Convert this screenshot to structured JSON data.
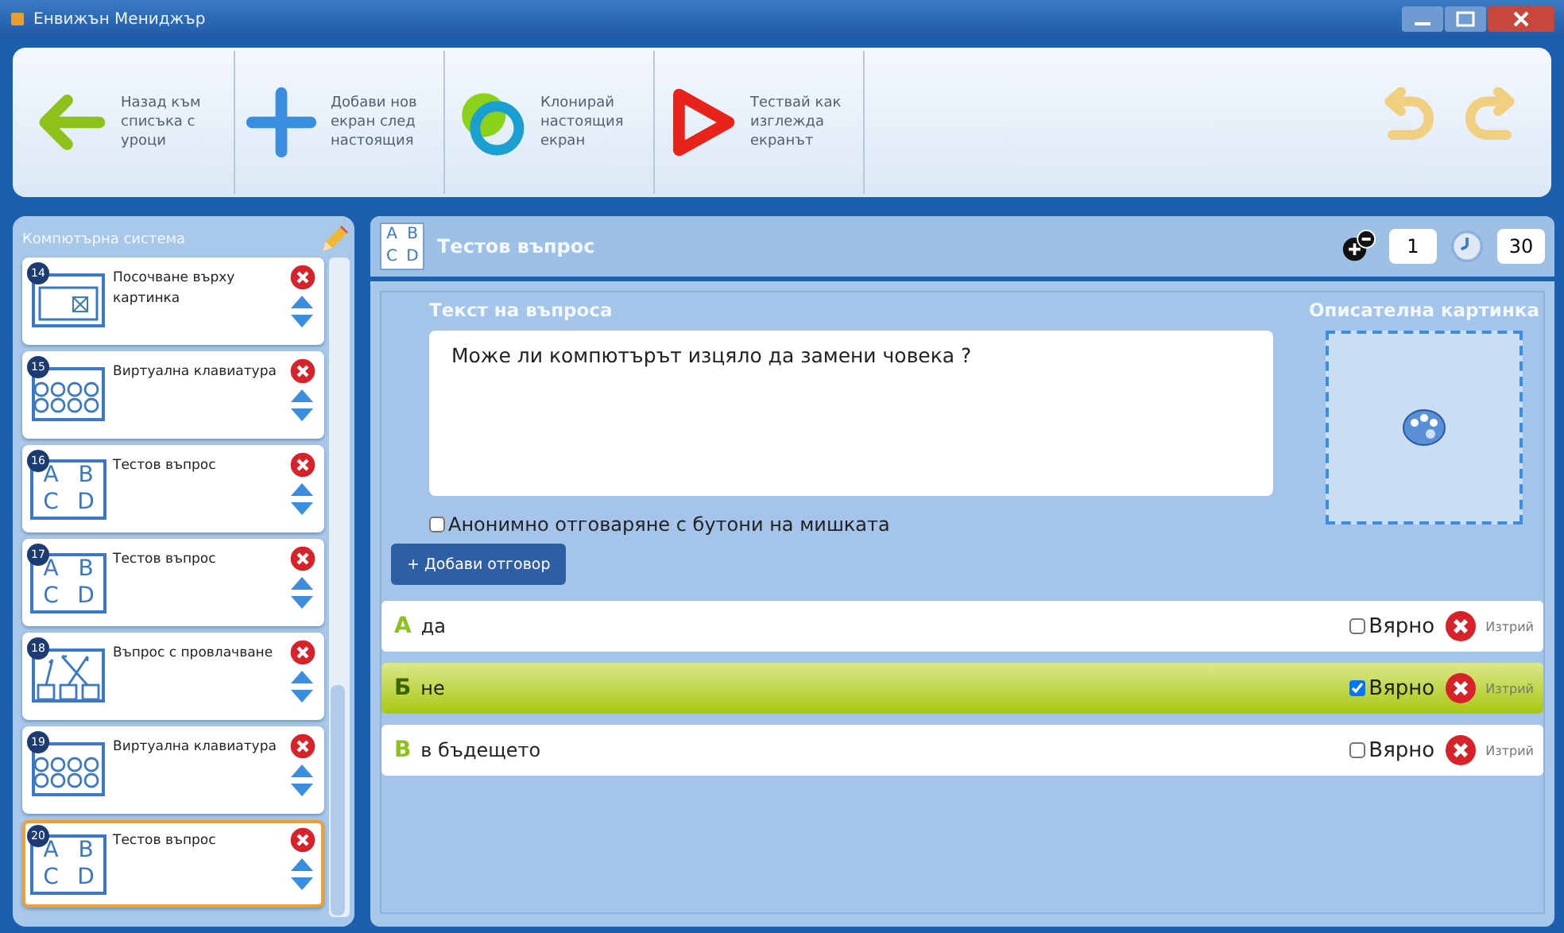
{
  "window": {
    "title": "Енвижън Мениджър"
  },
  "toolbar": [
    {
      "kind": "back",
      "label": "Назад към списъка с уроци"
    },
    {
      "kind": "add",
      "label": "Добави нов екран след настоящия"
    },
    {
      "kind": "clone",
      "label": "Клонирай настоящия екран"
    },
    {
      "kind": "test",
      "label": "Тествай как изглежда екранът"
    }
  ],
  "sidebar": {
    "title": "Компютърна система",
    "items": [
      {
        "number": "14",
        "kind": "pointing",
        "label": "Посочване върху картинка",
        "selected": false
      },
      {
        "number": "15",
        "kind": "keyboard",
        "label": "Виртуална клавиатура",
        "selected": false
      },
      {
        "number": "16",
        "kind": "abcd",
        "letters": [
          "A",
          "B",
          "C",
          "D"
        ],
        "label": "Тестов въпрос",
        "selected": false
      },
      {
        "number": "17",
        "kind": "abcd",
        "letters": [
          "A",
          "B",
          "C",
          "D"
        ],
        "label": "Тестов въпрос",
        "selected": false
      },
      {
        "number": "18",
        "kind": "drag",
        "label": "Въпрос с провлачване",
        "selected": false
      },
      {
        "number": "19",
        "kind": "keyboard",
        "label": "Виртуална клавиатура",
        "selected": false
      },
      {
        "number": "20",
        "kind": "abcd",
        "letters": [
          "A",
          "B",
          "C",
          "D"
        ],
        "label": "Тестов въпрос",
        "selected": true
      }
    ]
  },
  "header": {
    "letters": [
      "A",
      "B",
      "C",
      "D"
    ],
    "title": "Тестов въпрос",
    "points": "1",
    "seconds": "30"
  },
  "question": {
    "label": "Текст на въпроса",
    "value": "Може ли компютърът изцяло да замени човека ?",
    "picture_label": "Описателна картинка",
    "anonymous": {
      "label": "Анонимно отговаряне с бутони на мишката",
      "checked": false
    },
    "add_button": "+ Добави отговор"
  },
  "answers": [
    {
      "letter": "А",
      "text": "да",
      "correct": false,
      "correct_label": "Вярно",
      "delete_label": "Изтрий",
      "selected": false
    },
    {
      "letter": "Б",
      "text": "не",
      "correct": true,
      "correct_label": "Вярно",
      "delete_label": "Изтрий",
      "selected": true
    },
    {
      "letter": "В",
      "text": "в бъдещето",
      "correct": false,
      "correct_label": "Вярно",
      "delete_label": "Изтрий",
      "selected": false
    }
  ]
}
